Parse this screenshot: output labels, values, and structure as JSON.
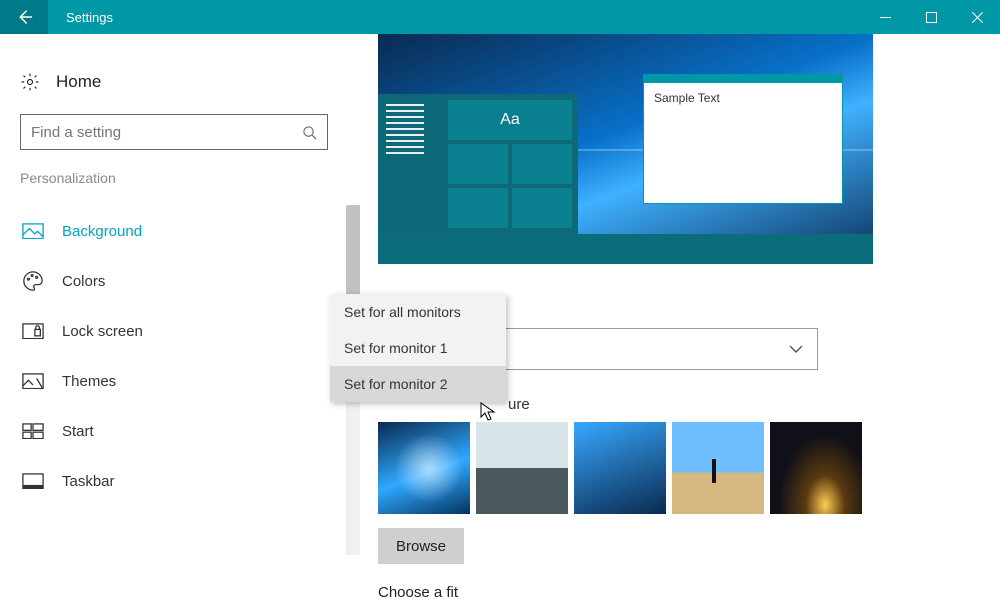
{
  "titlebar": {
    "title": "Settings"
  },
  "sidebar": {
    "home": "Home",
    "search_placeholder": "Find a setting",
    "category": "Personalization",
    "items": [
      {
        "label": "Background",
        "active": true
      },
      {
        "label": "Colors"
      },
      {
        "label": "Lock screen"
      },
      {
        "label": "Themes"
      },
      {
        "label": "Start"
      },
      {
        "label": "Taskbar"
      }
    ]
  },
  "preview": {
    "tile_text": "Aa",
    "sample_window": "Sample Text"
  },
  "context_menu": {
    "items": [
      "Set for all monitors",
      "Set for monitor 1",
      "Set for monitor 2"
    ],
    "highlighted_index": 2
  },
  "main": {
    "partial_label": "ure",
    "browse": "Browse",
    "fit_label": "Choose a fit"
  }
}
